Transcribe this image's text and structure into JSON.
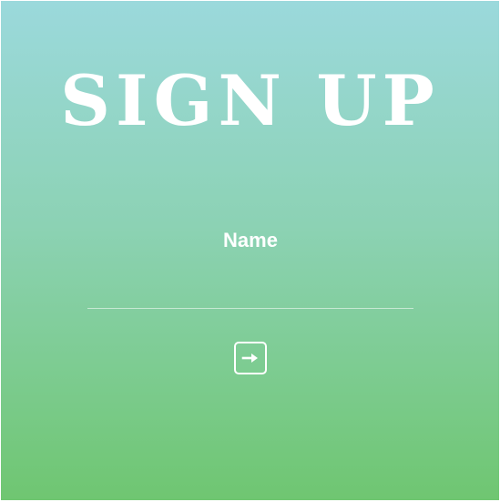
{
  "page": {
    "title": "SIGN UP"
  },
  "form": {
    "name_label": "Name",
    "name_value": "",
    "name_placeholder": ""
  },
  "submit": {
    "icon": "arrow-right-icon"
  },
  "colors": {
    "gradient_top": "#9bd9dc",
    "gradient_bottom": "#6fc671",
    "text": "#ffffff"
  }
}
